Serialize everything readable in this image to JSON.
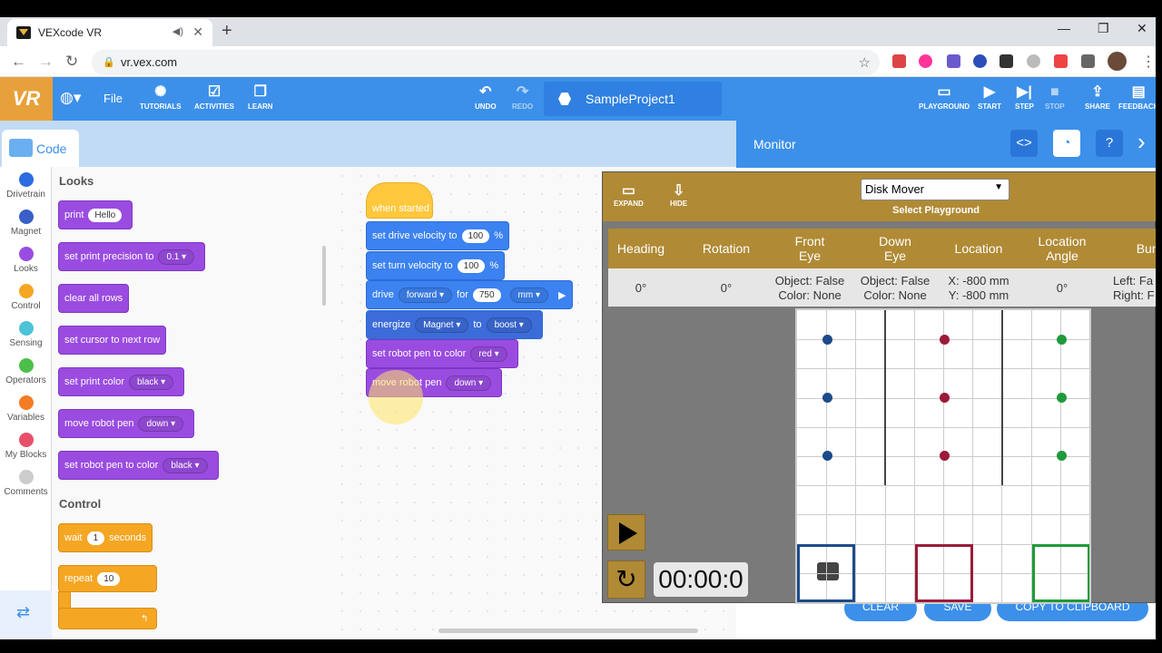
{
  "browser": {
    "tab_title": "VEXcode VR",
    "tab_close": "✕",
    "new_tab": "+",
    "url": "vr.vex.com",
    "window_controls": [
      "—",
      "❐",
      "✕"
    ]
  },
  "toolbar": {
    "logo": "VR",
    "file": "File",
    "tutorials": "TUTORIALS",
    "activities": "ACTIVITIES",
    "learn": "LEARN",
    "undo": "UNDO",
    "redo": "REDO",
    "project_name": "SampleProject1",
    "playground": "PLAYGROUND",
    "start": "START",
    "step": "STEP",
    "stop": "STOP",
    "share": "SHARE",
    "feedback": "FEEDBACK"
  },
  "code_tab": "Code",
  "categories": [
    "Drivetrain",
    "Magnet",
    "Looks",
    "Control",
    "Sensing",
    "Operators",
    "Variables",
    "My Blocks",
    "Comments"
  ],
  "category_colors": [
    "#2d6be0",
    "#3a5fc7",
    "#9a4ce0",
    "#f5a623",
    "#4fc3d9",
    "#4cbf4b",
    "#f57c23",
    "#e8506a",
    "#cccccc"
  ],
  "palette": {
    "looks_title": "Looks",
    "print": "print",
    "print_value": "Hello",
    "set_precision": "set print precision to",
    "precision_value": "0.1",
    "clear_rows": "clear all rows",
    "set_cursor": "set cursor to next row",
    "set_print_color": "set print color",
    "print_color_value": "black",
    "move_pen": "move robot pen",
    "move_pen_value": "down",
    "set_pen_color": "set robot pen to color",
    "pen_color_value": "black",
    "control_title": "Control",
    "wait": "wait",
    "wait_value": "1",
    "seconds": "seconds",
    "repeat": "repeat",
    "repeat_value": "10"
  },
  "script": {
    "when_started": "when started",
    "drive_velocity": "set drive velocity to",
    "drive_velocity_value": "100",
    "turn_velocity": "set turn velocity to",
    "turn_velocity_value": "100",
    "percent": "%",
    "drive": "drive",
    "drive_dir": "forward",
    "for": "for",
    "drive_distance": "750",
    "drive_unit": "mm",
    "energize": "energize",
    "magnet": "Magnet",
    "to": "to",
    "boost": "boost",
    "pen_color": "set robot pen to color",
    "pen_color_value": "red",
    "move_pen": "move robot pen",
    "move_pen_value": "down"
  },
  "monitor": {
    "title": "Monitor",
    "clear": "CLEAR",
    "save": "SAVE",
    "copy": "COPY TO CLIPBOARD"
  },
  "playground": {
    "expand": "EXPAND",
    "hide": "HIDE",
    "selected": "Disk Mover",
    "select_label": "Select Playground",
    "headers": [
      "Heading",
      "Rotation",
      "Front\nEye",
      "Down\nEye",
      "Location",
      "Location\nAngle",
      "Bump"
    ],
    "values": [
      "0°",
      "0°",
      "Object: False\nColor: None",
      "Object: False\nColor: None",
      "X: -800 mm\nY: -800 mm",
      "0°",
      "Left: Fa\nRight: F"
    ],
    "timer": "00:00:0",
    "disk_colors": [
      "#1d4a8a",
      "#9b1b3a",
      "#1f9a3a"
    ],
    "goal_colors": [
      "#1d4a8a",
      "#9b1b3a",
      "#1f9a3a"
    ]
  }
}
